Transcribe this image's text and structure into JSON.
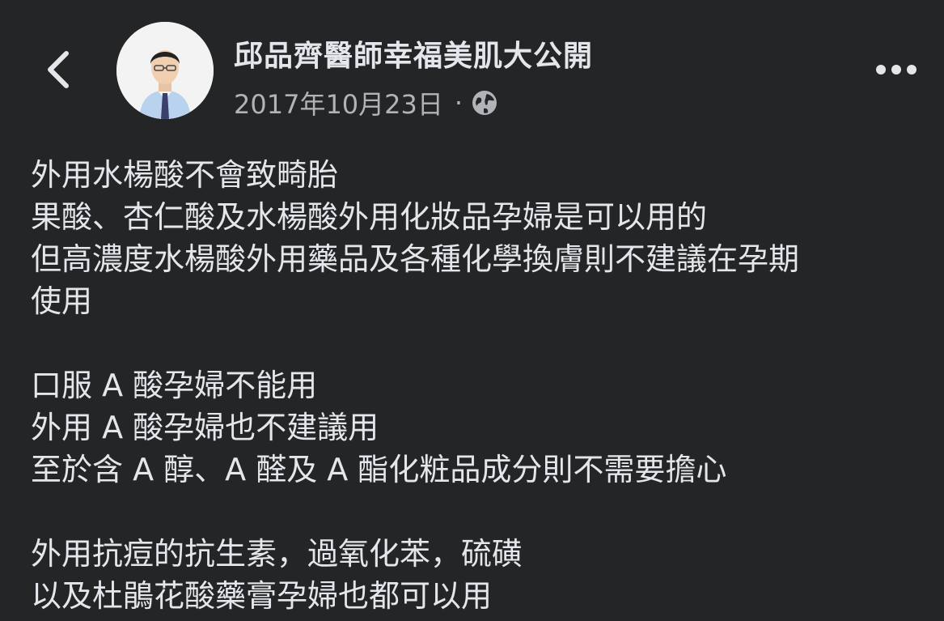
{
  "header": {
    "page_name": "邱品齊醫師幸福美肌大公開",
    "date": "2017年10月23日",
    "separator": "·",
    "icons": {
      "back": "chevron-left-icon",
      "privacy": "globe-icon",
      "more": "more-horizontal-icon"
    }
  },
  "post": {
    "paragraphs": [
      [
        "外用水楊酸不會致畸胎",
        "果酸、杏仁酸及水楊酸外用化妝品孕婦是可以用的",
        "但高濃度水楊酸外用藥品及各種化學換膚則不建議在孕期",
        "使用"
      ],
      [
        "口服 A 酸孕婦不能用",
        "外用 A 酸孕婦也不建議用",
        "至於含 A 醇、A 醛及 A 酯化粧品成分則不需要擔心"
      ],
      [
        "外用抗痘的抗生素，過氧化苯，硫磺",
        "以及杜鵑花酸藥膏孕婦也都可以用"
      ]
    ]
  },
  "colors": {
    "background": "#242526",
    "primary_text": "#e4e6eb",
    "secondary_text": "#b0b3b8"
  }
}
